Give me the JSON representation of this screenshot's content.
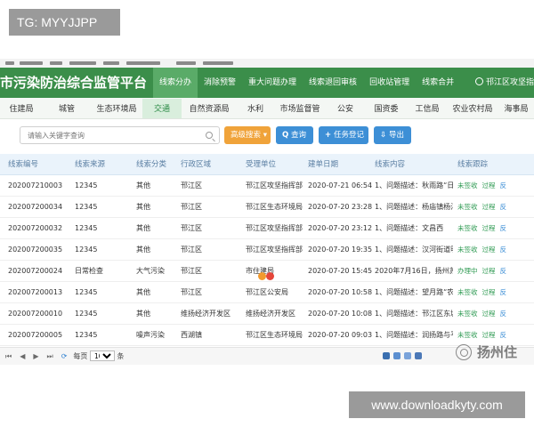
{
  "overlay": {
    "tg_label": "TG: MYYJJPP",
    "download_label": "www.downloadkyty.com",
    "watermark_text": "扬州住"
  },
  "app": {
    "title": "市污染防治综合监管平台",
    "user": "邗江区攻坚指",
    "colors": {
      "header": "#3b8e4a",
      "accent_green": "#2e9a52",
      "button_blue": "#3d8fd6",
      "button_orange": "#f0a33a"
    }
  },
  "topnav": [
    {
      "label": "线索分办",
      "active": true
    },
    {
      "label": "消除预警",
      "active": false
    },
    {
      "label": "重大问题办理",
      "active": false
    },
    {
      "label": "线索退回审核",
      "active": false
    },
    {
      "label": "回收站管理",
      "active": false
    },
    {
      "label": "线索合并",
      "active": false
    }
  ],
  "departments": [
    {
      "label": "住建局",
      "active": false
    },
    {
      "label": "城管",
      "active": false
    },
    {
      "label": "生态环境局",
      "active": false
    },
    {
      "label": "交通",
      "active": true
    },
    {
      "label": "自然资源局",
      "active": false
    },
    {
      "label": "水利",
      "active": false
    },
    {
      "label": "市场监督管",
      "active": false
    },
    {
      "label": "公安",
      "active": false
    },
    {
      "label": "国资委",
      "active": false
    },
    {
      "label": "工信局",
      "active": false
    },
    {
      "label": "农业农村局",
      "active": false
    },
    {
      "label": "海事局",
      "active": false
    }
  ],
  "toolbar": {
    "search_placeholder": "请输入关键字查询",
    "advanced_search": "高级搜索",
    "query": "查询",
    "register": "任务登记",
    "export": "导出",
    "dropdown_glyph": "▾",
    "query_glyph": "Q",
    "register_glyph": "+",
    "export_glyph": "⇩"
  },
  "table": {
    "columns": [
      "线索编号",
      "线索来源",
      "线索分类",
      "行政区域",
      "受理单位",
      "建单日期",
      "线索内容",
      "线索跟踪"
    ],
    "rows": [
      {
        "id": "202007210003",
        "source": "12345",
        "category": "其他",
        "region": "邗江区",
        "unit": "邗江区攻坚指挥部",
        "date": "2020-07-21 06:54",
        "content": "1、问题描述：秋雨路“日",
        "actions": [
          "未签收",
          "过程",
          "反"
        ]
      },
      {
        "id": "202007200034",
        "source": "12345",
        "category": "其他",
        "region": "邗江区",
        "unit": "邗江区生态环境局",
        "date": "2020-07-20 23:28",
        "content": "1、问题描述：杨庙镇杨汤",
        "actions": [
          "未签收",
          "过程",
          "反"
        ]
      },
      {
        "id": "202007200032",
        "source": "12345",
        "category": "其他",
        "region": "邗江区",
        "unit": "邗江区攻坚指挥部",
        "date": "2020-07-20 23:12",
        "content": "1、问题描述：文昌西",
        "actions": [
          "未签收",
          "过程",
          "反"
        ]
      },
      {
        "id": "202007200035",
        "source": "12345",
        "category": "其他",
        "region": "邗江区",
        "unit": "邗江区攻坚指挥部",
        "date": "2020-07-20 19:35",
        "content": "1、问题描述：汉河街道明",
        "actions": [
          "未签收",
          "过程",
          "反"
        ]
      },
      {
        "id": "202007200024",
        "source": "日常检查",
        "category": "大气污染",
        "region": "邗江区",
        "unit": "市住建局",
        "date": "2020-07-20 15:45",
        "content": "2020年7月16日，扬州苏设",
        "actions": [
          "办理中",
          "过程",
          "反"
        ]
      },
      {
        "id": "202007200013",
        "source": "12345",
        "category": "其他",
        "region": "邗江区",
        "unit": "邗江区公安局",
        "date": "2020-07-20 10:58",
        "content": "1、问题描述：望月路“农",
        "actions": [
          "未签收",
          "过程",
          "反"
        ]
      },
      {
        "id": "202007200010",
        "source": "12345",
        "category": "其他",
        "region": "维扬经济开发区",
        "unit": "维扬经济开发区",
        "date": "2020-07-20 10:08",
        "content": "1、问题描述：邗江区东城",
        "actions": [
          "未签收",
          "过程",
          "反"
        ]
      },
      {
        "id": "202007200005",
        "source": "12345",
        "category": "噪声污染",
        "region": "西湖镇",
        "unit": "邗江区生态环境局",
        "date": "2020-07-20 09:03",
        "content": "1、问题描述：润扬路与平",
        "actions": [
          "未签收",
          "过程",
          "反"
        ]
      }
    ]
  },
  "pager": {
    "per_page_label": "每页",
    "per_page_value": "10",
    "per_page_suffix": "条",
    "first_glyph": "⏮",
    "prev_glyph": "◀",
    "next_glyph": "▶",
    "last_glyph": "⏭",
    "refresh_glyph": "⟳"
  }
}
